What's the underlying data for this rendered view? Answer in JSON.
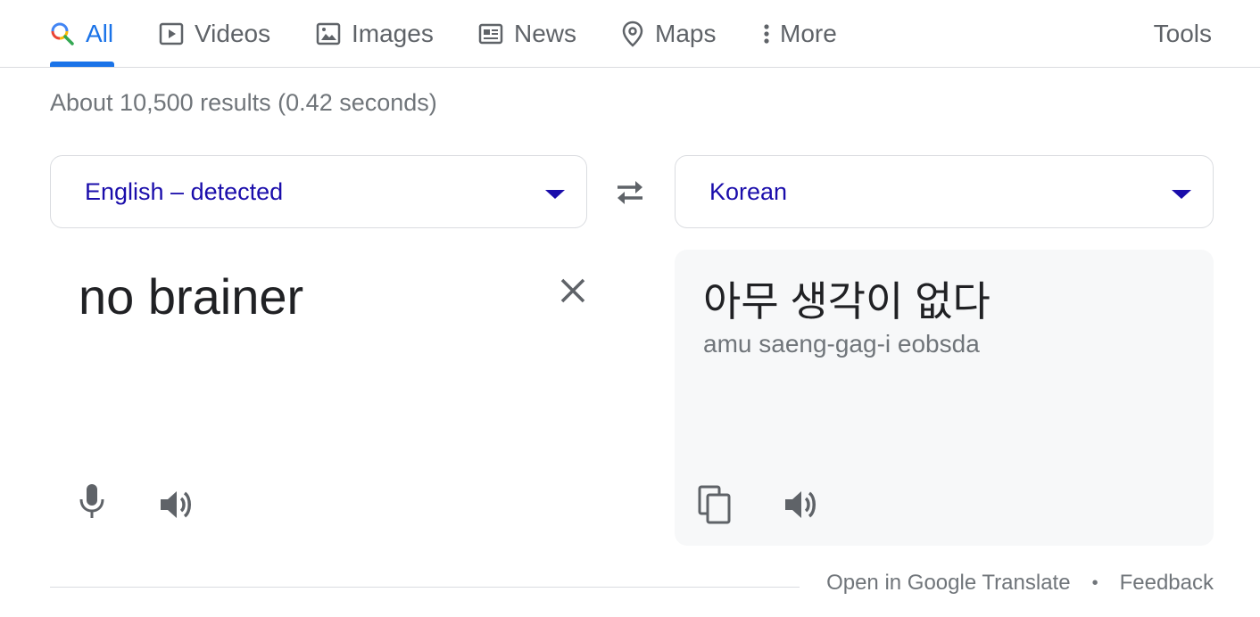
{
  "tabs": [
    {
      "label": "All",
      "icon": "search-icon",
      "active": true
    },
    {
      "label": "Videos",
      "icon": "video-icon"
    },
    {
      "label": "Images",
      "icon": "image-icon"
    },
    {
      "label": "News",
      "icon": "news-icon"
    },
    {
      "label": "Maps",
      "icon": "map-pin-icon"
    },
    {
      "label": "More",
      "icon": "more-vert-icon"
    }
  ],
  "tools_label": "Tools",
  "result_stats": "About 10,500 results (0.42 seconds)",
  "translator": {
    "source_language": "English – detected",
    "target_language": "Korean",
    "source_text": "no brainer",
    "translated_text": "아무 생각이 없다",
    "romanization": "amu saeng-gag-i eobsda"
  },
  "footer": {
    "open_link": "Open in Google Translate",
    "separator": "•",
    "feedback_link": "Feedback"
  },
  "colors": {
    "accent": "#1a73e8",
    "link": "#1a0dab",
    "muted": "#70757a",
    "icon": "#5f6368",
    "panel": "#f7f8f9"
  }
}
